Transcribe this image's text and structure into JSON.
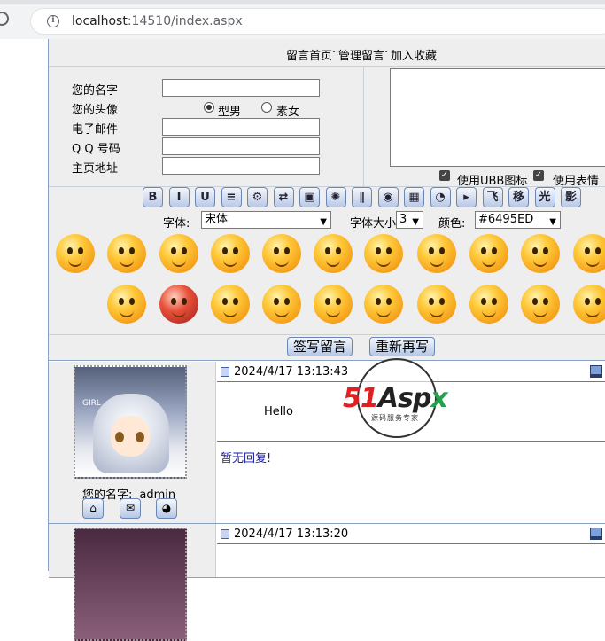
{
  "browser": {
    "url_host": "localhost",
    "url_rest": ":14510/index.aspx"
  },
  "nav": {
    "home": "留言首页",
    "sep1": "·",
    "manage": "管理留言",
    "sep2": "·",
    "bookmark": "加入收藏"
  },
  "form": {
    "name_label": "您的名字",
    "avatar_label": "您的头像",
    "gender_options": [
      "型男",
      "素女"
    ],
    "selected_gender": "型男",
    "email_label": "电子邮件",
    "qq_label": "Q Q 号码",
    "homepage_label": "主页地址",
    "use_ubb": "使用UBB图标",
    "use_emote": "使用表情"
  },
  "toolbar": {
    "buttons": [
      "B",
      "I",
      "U",
      "≡",
      "⚙",
      "⇄",
      "▣",
      "✺",
      "∥",
      "◉",
      "▦",
      "◔",
      "▸",
      "飞",
      "移",
      "光",
      "影"
    ],
    "font_label": "字体:",
    "font_value": "宋体",
    "size_label": "字体大小",
    "size_value": "3",
    "color_label": "颜色:",
    "color_value": "#6495ED"
  },
  "actions": {
    "submit": "签写留言",
    "reset": "重新再写"
  },
  "entries": [
    {
      "time": "2024/4/17 13:13:43",
      "avatar_tag": "GIRL",
      "name_label": "您的名字:",
      "name_value": "admin",
      "content": "Hello",
      "reply": "暂无回复!"
    },
    {
      "time": "2024/4/17 13:13:20"
    }
  ],
  "watermark": {
    "brand_red": "51",
    "brand_dark": "Asp",
    "brand_green": "x",
    "sub": "源码服务专家"
  },
  "colors": {
    "nav_bg": "#eeeeee",
    "border": "#8aa1c1",
    "reply_text": "#1a1aa6",
    "button_gradient_end": "#b5c7e6"
  }
}
